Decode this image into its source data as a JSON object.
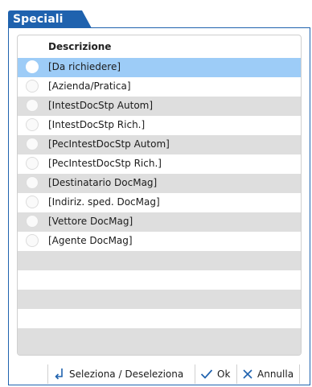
{
  "tab": {
    "title": "Speciali"
  },
  "grid": {
    "header": "Descrizione",
    "rows": [
      {
        "label": "[Da richiedere]",
        "selected": true
      },
      {
        "label": "[Azienda/Pratica]",
        "selected": false
      },
      {
        "label": "[IntestDocStp Autom]",
        "selected": false
      },
      {
        "label": "[IntestDocStp Rich.]",
        "selected": false
      },
      {
        "label": "[PecIntestDocStp Autom]",
        "selected": false
      },
      {
        "label": "[PecIntestDocStp Rich.]",
        "selected": false
      },
      {
        "label": "[Destinatario DocMag]",
        "selected": false
      },
      {
        "label": "[Indiriz. sped. DocMag]",
        "selected": false
      },
      {
        "label": "[Vettore DocMag]",
        "selected": false
      },
      {
        "label": "[Agente DocMag]",
        "selected": false
      }
    ]
  },
  "footer": {
    "toggle_label": "Seleziona / Deseleziona",
    "ok_label": "Ok",
    "cancel_label": "Annulla"
  },
  "colors": {
    "accent": "#1f62ae",
    "selection": "#9dccf7",
    "alt_row": "#dedede"
  }
}
